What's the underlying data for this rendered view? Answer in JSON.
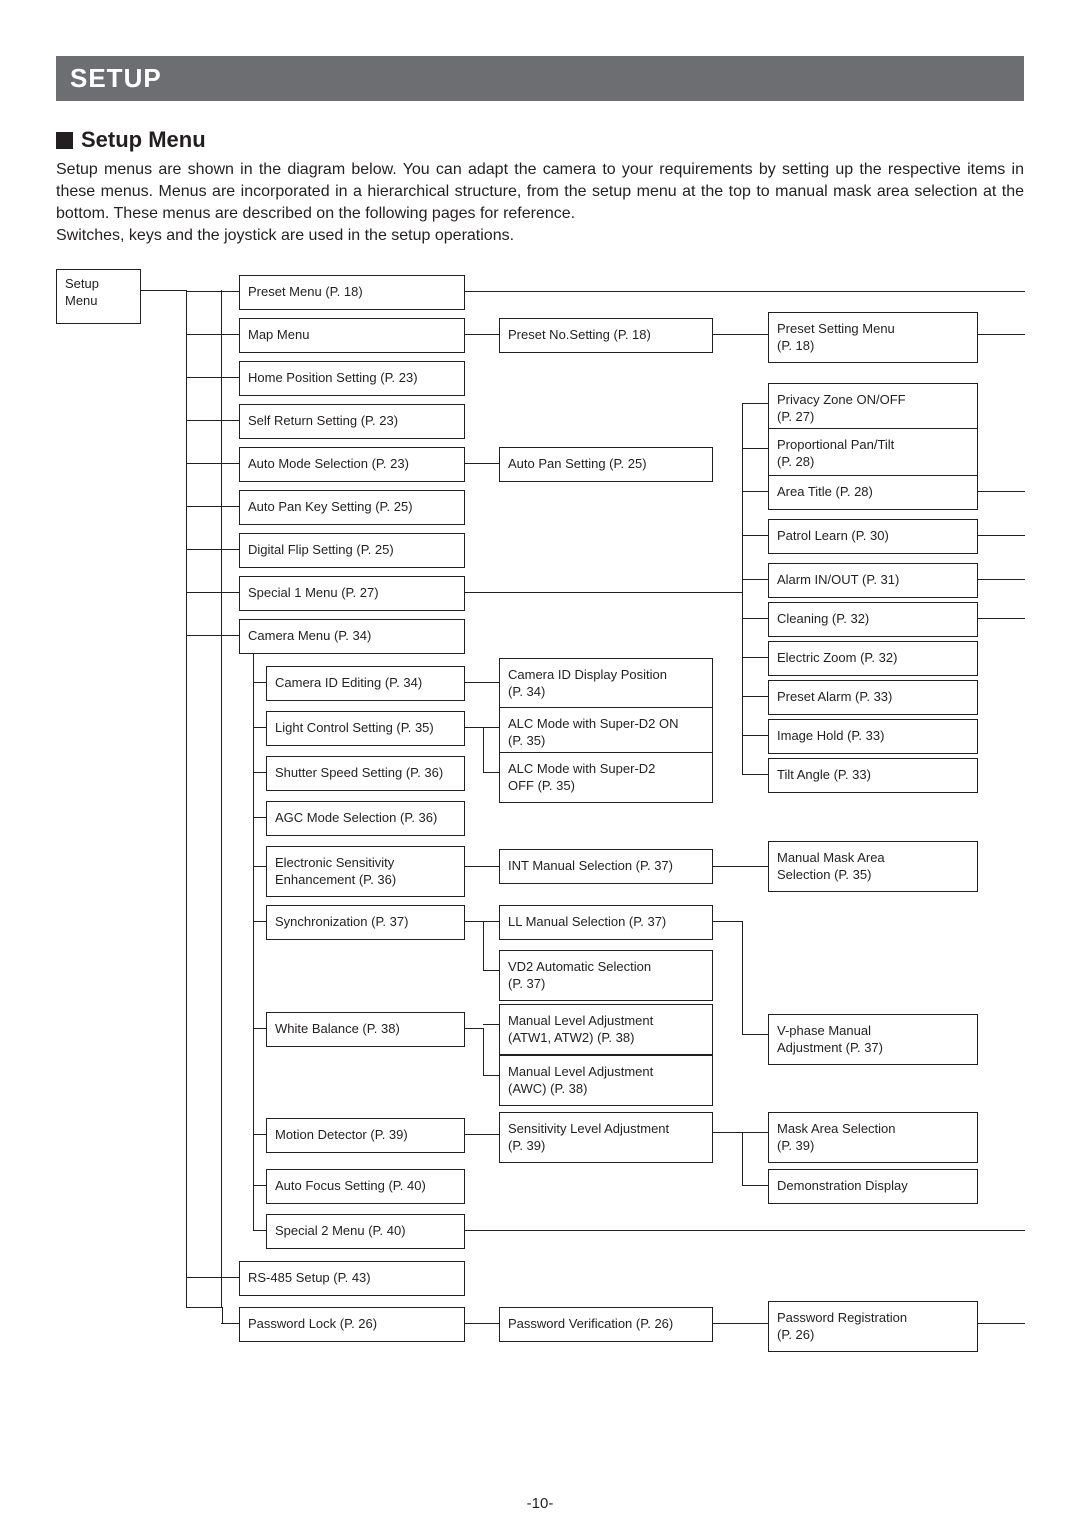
{
  "bar": "SETUP",
  "section": "Setup Menu",
  "intro": "Setup menus are shown in the diagram below. You can adapt the camera to your requirements by setting up the respective items in these menus.  Menus are incorporated in a hierarchical structure, from the setup menu at the top to manual mask area selection at the bottom. These menus are described on the following pages for reference.\nSwitches, keys and the joystick are used in the setup operations.",
  "root": "Setup\nMenu",
  "col2": {
    "preset": "Preset Menu (P. 18)",
    "map": "Map Menu",
    "home": "Home Position Setting (P. 23)",
    "selfret": "Self Return Setting (P. 23)",
    "automode": "Auto Mode Selection (P. 23)",
    "autopankey": "Auto Pan Key Setting (P. 25)",
    "digitalflip": "Digital Flip Setting (P. 25)",
    "spec1": "Special 1 Menu (P. 27)",
    "cam": "Camera Menu (P. 34)",
    "rs485": "RS-485 Setup (P. 43)",
    "pwlock": "Password Lock (P. 26)"
  },
  "col2b": {
    "camid": "Camera ID Editing (P. 34)",
    "light": "Light Control Setting (P. 35)",
    "shutter": "Shutter Speed Setting (P. 36)",
    "agc": "AGC Mode Selection (P. 36)",
    "esens": "Electronic Sensitivity\nEnhancement (P. 36)",
    "sync": "Synchronization (P. 37)",
    "wb": "White Balance (P. 38)",
    "motion": "Motion Detector (P. 39)",
    "autofocus": "Auto Focus Setting (P. 40)",
    "spec2": "Special 2 Menu (P. 40)"
  },
  "col3": {
    "presetno": "Preset No.Setting (P. 18)",
    "autopan": "Auto Pan Setting (P. 25)",
    "camidpos": "Camera ID Display Position\n(P. 34)",
    "alcd2on": "ALC Mode with Super-D2 ON\n(P. 35)",
    "alcd2off": "ALC Mode with Super-D2\nOFF (P. 35)",
    "intman": "INT Manual Selection (P. 37)",
    "llman": "LL Manual Selection (P. 37)",
    "vd2": "VD2 Automatic Selection\n(P. 37)",
    "manlev1": "Manual Level Adjustment\n(ATW1, ATW2) (P. 38)",
    "manlev2": "Manual Level Adjustment\n(AWC) (P. 38)",
    "senslev": "Sensitivity Level Adjustment\n(P. 39)",
    "pwver": "Password Verification (P. 26)"
  },
  "col4": {
    "presetmenu": "Preset Setting Menu\n(P. 18)",
    "privzone": "Privacy Zone ON/OFF\n(P. 27)",
    "proppt": "Proportional Pan/Tilt\n(P. 28)",
    "areatitle": "Area Title (P. 28)",
    "patrol": "Patrol Learn (P. 30)",
    "alarm": "Alarm IN/OUT (P. 31)",
    "cleaning": "Cleaning (P. 32)",
    "ezoom": "Electric Zoom (P. 32)",
    "presetalarm": "Preset Alarm (P. 33)",
    "imghold": "Image Hold (P. 33)",
    "tilt": "Tilt Angle (P. 33)",
    "mmask": "Manual Mask Area\nSelection (P. 35)",
    "vphase": "V-phase Manual\nAdjustment (P. 37)",
    "maskarea": "Mask Area Selection\n(P. 39)",
    "demo": "Demonstration Display",
    "pwreg": "Password Registration\n(P. 26)"
  },
  "pagenum": "-10-"
}
